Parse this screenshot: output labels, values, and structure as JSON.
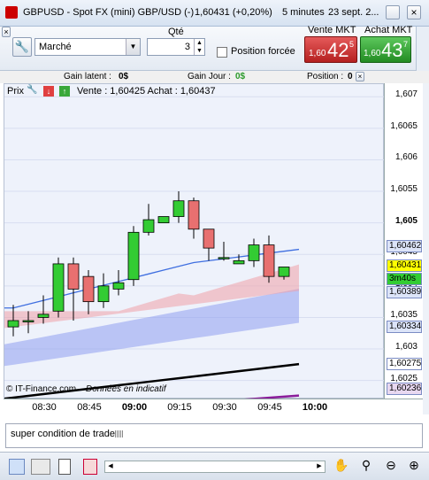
{
  "title": {
    "instrument": "GBPUSD - Spot FX (mini) GBP/USD (-)",
    "quote": "1,60431 (+0,20%)",
    "timeframe": "5 minutes",
    "date": "23 sept. 2..."
  },
  "order": {
    "type_value": "Marché",
    "qty_label": "Qté",
    "qty_value": "3",
    "forced_position_label": "Position forcée",
    "sell_label": "Vente MKT",
    "sell_prefix": "1,60",
    "sell_big": "42",
    "sell_sup": "5",
    "buy_label": "Achat MKT",
    "buy_prefix": "1,60",
    "buy_big": "43",
    "buy_sup": "7"
  },
  "info": {
    "latent_label": "Gain latent :",
    "latent_value": "0$",
    "day_label": "Gain Jour :",
    "day_value": "0$",
    "position_label": "Position :",
    "position_value": "0"
  },
  "chart_header": {
    "prix": "Prix",
    "sell_buy": "Vente : 1,60425 Achat : 1,60437"
  },
  "watermark": {
    "brand": "© IT-Finance.com",
    "note": "Données en indicatif"
  },
  "axis": {
    "y_ticks": [
      "1,607",
      "1,6065",
      "1,606",
      "1,6055",
      "1,605",
      "1,6045",
      "1,604",
      "1,6035",
      "1,603",
      "1,6025"
    ],
    "x_ticks": [
      "08:30",
      "08:45",
      "09:00",
      "09:15",
      "09:30",
      "09:45",
      "10:00"
    ],
    "price_boxes": [
      {
        "label": "1,60462",
        "bg": "#dce4f8"
      },
      {
        "label": "1,60431",
        "bg": "#ffff00"
      },
      {
        "label": "3m40s",
        "bg": "#33cc33"
      },
      {
        "label": "1,60389",
        "bg": "#dce4f8"
      },
      {
        "label": "1,60334",
        "bg": "#dce4f8"
      },
      {
        "label": "1,60275",
        "bg": "#ffffff"
      },
      {
        "label": "1,60236",
        "bg": "#e8d8f0"
      }
    ]
  },
  "comment": "super condition de trade",
  "colors": {
    "sell": "#d63c3c",
    "buy": "#3aa83a",
    "candle_up": "#33cc33",
    "candle_down": "#e87070",
    "band_red": "#f0a0a8",
    "band_blue": "#8f9ef0"
  },
  "chart_data": {
    "type": "candlestick",
    "x": [
      "08:20",
      "08:25",
      "08:30",
      "08:35",
      "08:40",
      "08:45",
      "08:50",
      "08:55",
      "09:00",
      "09:05",
      "09:10",
      "09:15",
      "09:20",
      "09:25",
      "09:30",
      "09:35",
      "09:40",
      "09:45",
      "09:50"
    ],
    "ohlc": [
      [
        1.60335,
        1.6037,
        1.6032,
        1.60345
      ],
      [
        1.60345,
        1.6036,
        1.60325,
        1.60345
      ],
      [
        1.6035,
        1.60385,
        1.6034,
        1.60355
      ],
      [
        1.6036,
        1.60445,
        1.6035,
        1.60435
      ],
      [
        1.60435,
        1.60445,
        1.60345,
        1.60395
      ],
      [
        1.60415,
        1.60425,
        1.60355,
        1.60375
      ],
      [
        1.60375,
        1.6042,
        1.60365,
        1.604
      ],
      [
        1.60395,
        1.60425,
        1.60385,
        1.60405
      ],
      [
        1.6041,
        1.60495,
        1.604,
        1.60485
      ],
      [
        1.60485,
        1.6053,
        1.6048,
        1.60505
      ],
      [
        1.605,
        1.6051,
        1.605,
        1.6051
      ],
      [
        1.6051,
        1.6055,
        1.605,
        1.60535
      ],
      [
        1.60535,
        1.6054,
        1.60475,
        1.6049
      ],
      [
        1.6049,
        1.6048,
        1.6044,
        1.6046
      ],
      [
        1.60445,
        1.6047,
        1.6044,
        1.60445
      ],
      [
        1.60435,
        1.6045,
        1.60435,
        1.6044
      ],
      [
        1.6044,
        1.60475,
        1.6043,
        1.60465
      ],
      [
        1.60465,
        1.6048,
        1.60405,
        1.60415
      ],
      [
        1.60415,
        1.6043,
        1.6041,
        1.6043
      ]
    ],
    "ylim": [
      1.6022,
      1.6072
    ]
  }
}
